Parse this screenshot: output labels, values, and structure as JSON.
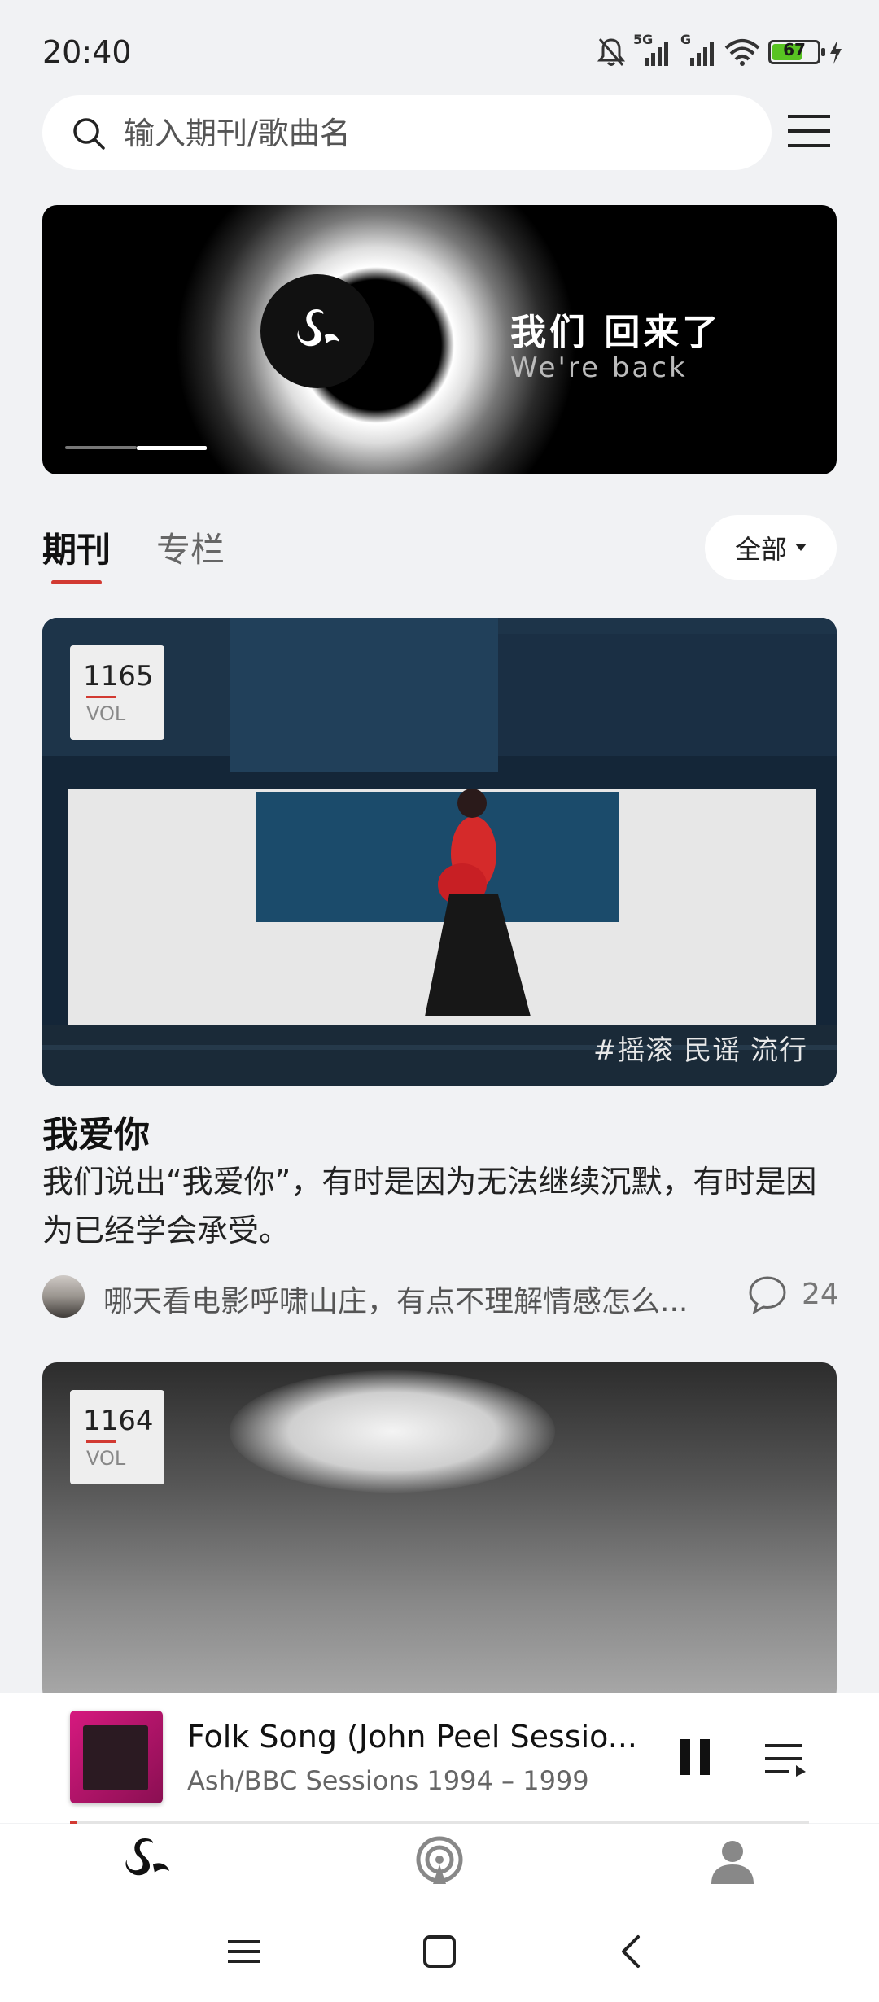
{
  "status_bar": {
    "time": "20:40",
    "network_1": "5G",
    "network_2": "G",
    "battery": "67",
    "battery_level": 0.67,
    "icons": [
      "mute-bell-icon",
      "signal-icon",
      "signal-icon",
      "wifi-icon",
      "battery-icon",
      "charging-icon"
    ]
  },
  "search": {
    "placeholder": "输入期刊/歌曲名"
  },
  "banner": {
    "title": "我们 回来了",
    "subtitle": "We're back",
    "slide_count": 2,
    "active_slide": 2
  },
  "tabs": [
    {
      "label": "期刊",
      "active": true
    },
    {
      "label": "专栏",
      "active": false
    }
  ],
  "filter": {
    "label": "全部"
  },
  "journals": [
    {
      "vol": "1165",
      "vol_label": "VOL",
      "tags": "#摇滚 民谣 流行",
      "title": "我爱你",
      "description": "我们说出“我爱你”，有时是因为无法继续沉默，有时是因为已经学会承受。",
      "comment_preview": "哪天看电影呼啸山庄，有点不理解情感怎么...",
      "comment_count": "24"
    },
    {
      "vol": "1164",
      "vol_label": "VOL"
    }
  ],
  "player": {
    "title": "Folk Song (John Peel Sessio...",
    "album": "Ash/BBC Sessions 1994 – 1999",
    "progress": 0.01,
    "state": "playing"
  },
  "bottom_nav": [
    "swan-home-icon",
    "podcast-icon",
    "profile-icon"
  ],
  "system_nav": [
    "menu-icon",
    "home-square-icon",
    "back-icon"
  ],
  "colors": {
    "accent": "#d23a32",
    "background": "#f1f2f4"
  }
}
